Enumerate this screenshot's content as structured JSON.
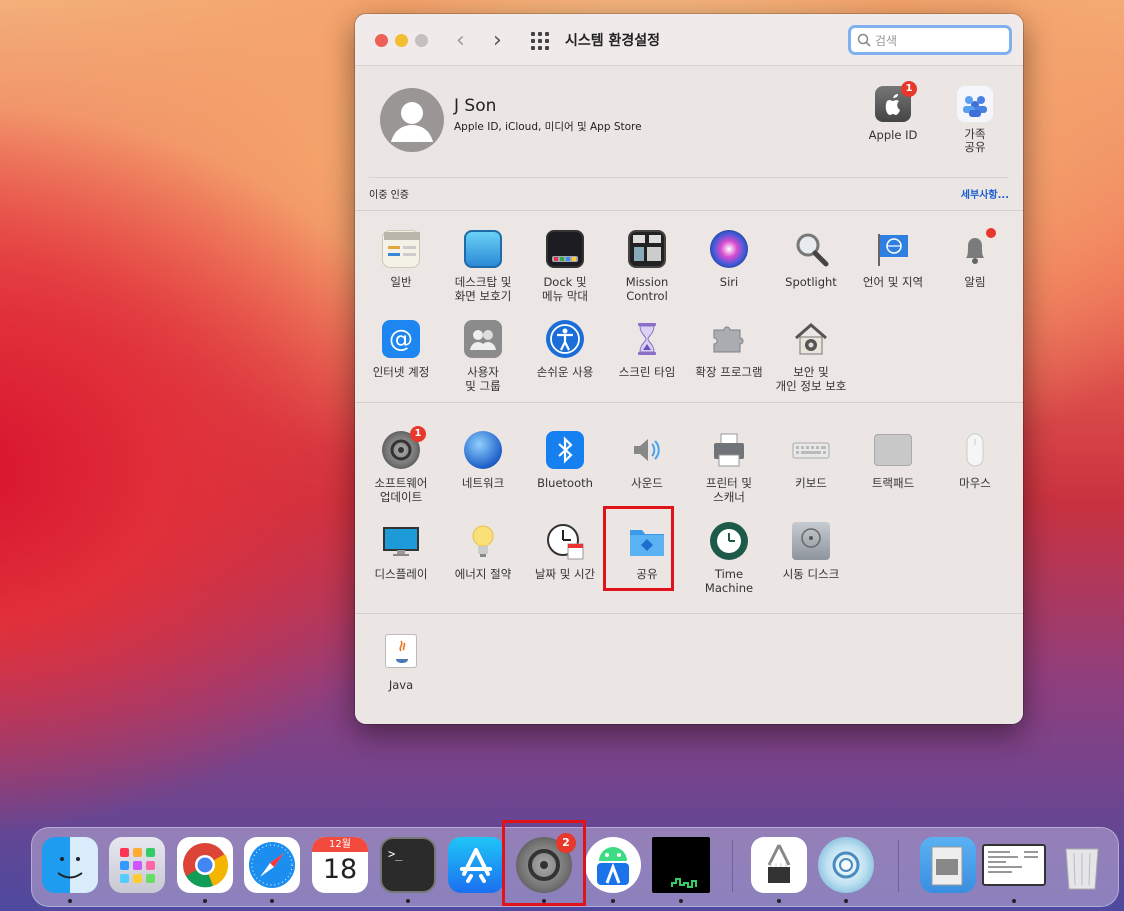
{
  "window": {
    "title": "시스템 환경설정",
    "search_placeholder": "검색",
    "nav_back": "‹",
    "nav_forward": "›"
  },
  "profile": {
    "name": "J Son",
    "subtitle": "Apple ID, iCloud, 미디어 및 App Store",
    "apple_id": {
      "label": "Apple ID",
      "badge": "1"
    },
    "family": {
      "label_line1": "가족",
      "label_line2": "공유"
    },
    "two_factor": "이중 인증",
    "details": "세부사항..."
  },
  "panes_row1": [
    {
      "line1": "일반",
      "line2": ""
    },
    {
      "line1": "데스크탑 및",
      "line2": "화면 보호기"
    },
    {
      "line1": "Dock 및",
      "line2": "메뉴 막대"
    },
    {
      "line1": "Mission",
      "line2": "Control"
    },
    {
      "line1": "Siri",
      "line2": ""
    },
    {
      "line1": "Spotlight",
      "line2": ""
    },
    {
      "line1": "언어 및 지역",
      "line2": ""
    },
    {
      "line1": "알림",
      "line2": ""
    }
  ],
  "panes_row2": [
    {
      "line1": "인터넷 계정",
      "line2": ""
    },
    {
      "line1": "사용자",
      "line2": "및 그룹"
    },
    {
      "line1": "손쉬운 사용",
      "line2": ""
    },
    {
      "line1": "스크린 타임",
      "line2": ""
    },
    {
      "line1": "확장 프로그램",
      "line2": ""
    },
    {
      "line1": "보안 및",
      "line2": "개인 정보 보호"
    }
  ],
  "panes_row3": [
    {
      "line1": "소프트웨어",
      "line2": "업데이트",
      "badge": "1"
    },
    {
      "line1": "네트워크",
      "line2": ""
    },
    {
      "line1": "Bluetooth",
      "line2": ""
    },
    {
      "line1": "사운드",
      "line2": ""
    },
    {
      "line1": "프린터 및",
      "line2": "스캐너"
    },
    {
      "line1": "키보드",
      "line2": ""
    },
    {
      "line1": "트랙패드",
      "line2": ""
    },
    {
      "line1": "마우스",
      "line2": ""
    }
  ],
  "panes_row4": [
    {
      "line1": "디스플레이",
      "line2": ""
    },
    {
      "line1": "에너지 절약",
      "line2": ""
    },
    {
      "line1": "날짜 및 시간",
      "line2": ""
    },
    {
      "line1": "공유",
      "line2": ""
    },
    {
      "line1": "Time",
      "line2": "Machine"
    },
    {
      "line1": "시동 디스크",
      "line2": ""
    }
  ],
  "panes_row5": [
    {
      "line1": "Java",
      "line2": ""
    }
  ],
  "dock": {
    "calendar_month": "12월",
    "calendar_day": "18",
    "terminal_prompt": ">_",
    "sysprefs_badge": "2"
  }
}
